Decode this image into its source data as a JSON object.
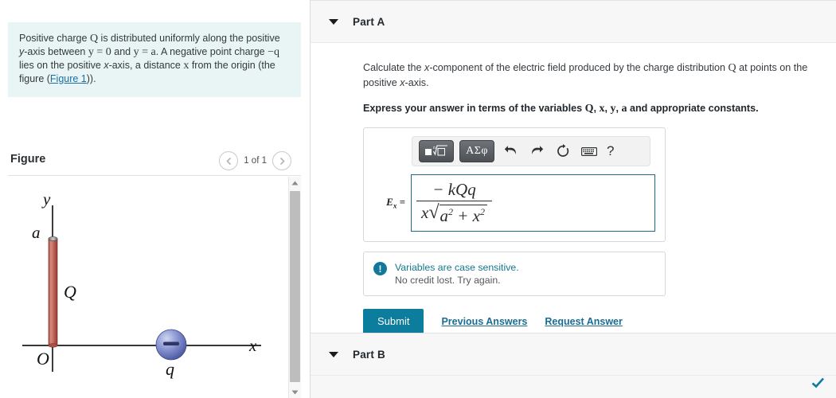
{
  "problem": {
    "text_segments": [
      "Positive charge ",
      "Q",
      " is distributed uniformly along the positive ",
      "y",
      "-axis between ",
      "y = 0",
      " and ",
      "y = a",
      ". A negative point charge ",
      "−q",
      " lies on the positive ",
      "x",
      "-axis, a distance ",
      "x",
      " from the origin (the figure (",
      "Figure 1",
      "))."
    ],
    "figure_link": "Figure 1"
  },
  "figure": {
    "title": "Figure",
    "counter": "1 of 1",
    "prev_icon": "chevron-left-icon",
    "next_icon": "chevron-right-icon",
    "labels": {
      "y_axis": "y",
      "x_axis": "x",
      "origin": "O",
      "rod_top": "a",
      "rod_charge": "Q",
      "point_charge": "q",
      "charge_sign": "−"
    },
    "colors": {
      "rod": "#c4685e",
      "rod_edge": "#8f3b33",
      "sphere": "#6b7fc4",
      "axis": "#1a1a1a"
    }
  },
  "part_a": {
    "label": "Part A",
    "caret_icon": "caret-down-icon",
    "question": {
      "prefix": "Calculate the ",
      "var1": "x",
      "mid": "-component of the electric field produced by the charge distribution ",
      "var2": "Q",
      "suffix": " at points on the positive ",
      "var3": "x",
      "tail": "-axis."
    },
    "instruction": {
      "prefix": "Express your answer in terms of the variables ",
      "v1": "Q",
      "c1": ", ",
      "v2": "x",
      "c2": ", ",
      "v3": "y",
      "c3": ", ",
      "v4": "a",
      "suffix": " and appropriate constants."
    },
    "toolbar": {
      "template_button": "template-root-icon",
      "greek_button": "ΑΣφ",
      "undo_icon": "undo-icon",
      "redo_icon": "redo-icon",
      "reset_icon": "reset-icon",
      "keyboard_icon": "keyboard-icon",
      "help_label": "?"
    },
    "answer": {
      "lhs": "E",
      "lhs_sub": "x",
      "equals": "=",
      "numerator": "− kQq",
      "den_prefix": "x",
      "den_radicand_a": "a",
      "den_exp_a": "2",
      "den_plus": "+",
      "den_radicand_x": "x",
      "den_exp_x": "2"
    },
    "feedback": {
      "icon": "exclamation-icon",
      "line1": "Variables are case sensitive.",
      "line2": "No credit lost. Try again."
    },
    "buttons": {
      "submit": "Submit",
      "previous_answers": "Previous Answers",
      "request_answer": "Request Answer"
    }
  },
  "part_b": {
    "label": "Part B",
    "caret_icon": "caret-down-icon",
    "status_icon": "checkmark-icon"
  },
  "colors": {
    "accent": "#0d7d9e",
    "link": "#1a6c93",
    "problem_bg": "#e8f5f4",
    "header_bg": "#f7f7f7",
    "check": "#0f7ba5"
  }
}
